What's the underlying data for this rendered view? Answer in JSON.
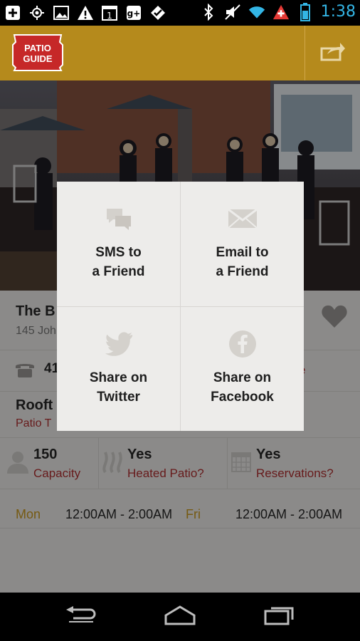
{
  "status_bar": {
    "time": "1:38",
    "icons": [
      "add-box-icon",
      "gps-icon",
      "image-icon",
      "warning-icon",
      "calendar-icon",
      "google-plus-icon",
      "foursquare-icon",
      "bluetooth-icon",
      "mute-icon",
      "wifi-icon",
      "swiss-flag-icon",
      "battery-icon"
    ],
    "calendar_day": "1",
    "google_plus_label": "g+"
  },
  "app_bar": {
    "logo_line1": "PATIO",
    "logo_line2": "GUIDE",
    "share_icon": "share-icon",
    "brand_color": "#b58a1c"
  },
  "venue": {
    "title_visible": "The B",
    "address_visible": "145 Joh",
    "phone_visible": "41",
    "website_visible": "e",
    "type_visible": "Rooft",
    "type_sub_visible": "Patio T"
  },
  "stats": [
    {
      "value": "150",
      "label": "Capacity",
      "icon": "person-icon"
    },
    {
      "value": "Yes",
      "label": "Heated Patio?",
      "icon": "heat-icon"
    },
    {
      "value": "Yes",
      "label": "Reservations?",
      "icon": "calendar-grid-icon"
    }
  ],
  "hours": [
    {
      "day": "Mon",
      "time": "12:00AM - 2:00AM"
    },
    {
      "day": "Fri",
      "time": "12:00AM - 2:00AM"
    }
  ],
  "share_dialog": {
    "options": [
      {
        "label": "SMS to\na Friend",
        "icon": "chat-bubbles-icon"
      },
      {
        "label": "Email to\na Friend",
        "icon": "envelope-icon"
      },
      {
        "label": "Share on\nTwitter",
        "icon": "twitter-icon"
      },
      {
        "label": "Share on\nFacebook",
        "icon": "facebook-icon"
      }
    ]
  },
  "nav_bar": {
    "buttons": [
      "back-icon",
      "home-icon",
      "recent-apps-icon"
    ]
  },
  "colors": {
    "accent_red": "#9e2a2b",
    "accent_gold": "#b58a1c",
    "status_time": "#33b5e5"
  }
}
